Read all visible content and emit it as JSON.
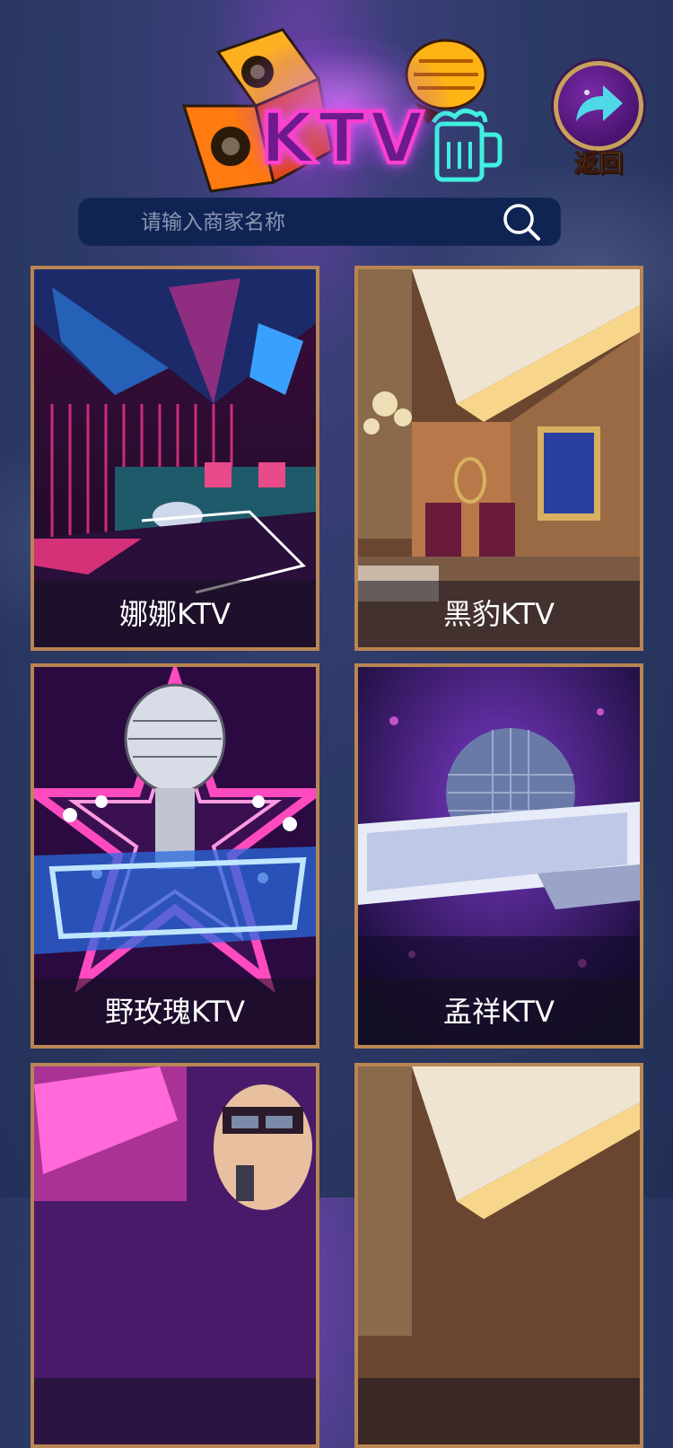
{
  "header": {
    "logo_text": "KTV",
    "back_label": "返回"
  },
  "search": {
    "placeholder": "请输入商家名称",
    "value": ""
  },
  "venues": [
    {
      "name": "娜娜KTV"
    },
    {
      "name": "黑豹KTV"
    },
    {
      "name": "野玫瑰KTV"
    },
    {
      "name": "孟祥KTV"
    },
    {
      "name": ""
    },
    {
      "name": ""
    }
  ],
  "colors": {
    "card_border": "#b98552",
    "search_bg": "#0f2453",
    "back_label": "#ffd84a",
    "logo_stroke": "#ff3fd0"
  },
  "icons": {
    "back": "arrow-right-icon",
    "search": "search-icon"
  }
}
